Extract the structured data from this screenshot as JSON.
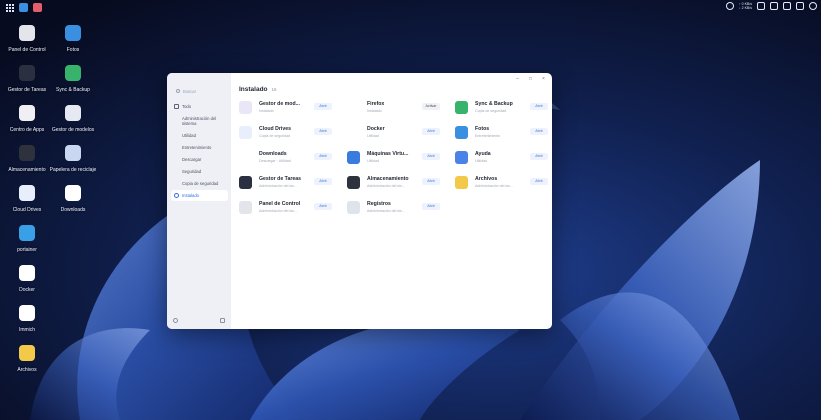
{
  "desktop": {
    "icons": [
      {
        "label": "Panel de Control",
        "icon": "control-panel-icon",
        "color": "#e3e5ea"
      },
      {
        "label": "Fotos",
        "icon": "photos-icon",
        "color": "#3a8fe0"
      },
      {
        "label": "Gestor de Tareas",
        "icon": "task-manager-icon",
        "color": "#2b3040"
      },
      {
        "label": "Sync & Backup",
        "icon": "sync-icon",
        "color": "#37b36b"
      },
      {
        "label": "Centro de Apps",
        "icon": "app-center-icon",
        "color": "#f0f0f4"
      },
      {
        "label": "Gestor de modelos",
        "icon": "model-manager-icon",
        "color": "#e7e9f2"
      },
      {
        "label": "Almacenamiento",
        "icon": "storage-icon",
        "color": "#2e323c"
      },
      {
        "label": "Papelera de reciclaje",
        "icon": "trash-icon",
        "color": "#c9d8f0"
      },
      {
        "label": "Cloud Drives",
        "icon": "cloud-drives-icon",
        "color": "#e8eefb"
      },
      {
        "label": "Downloads",
        "icon": "downloads-icon",
        "color": "#ffffff"
      },
      {
        "label": "portainer",
        "icon": "portainer-icon",
        "color": "#39a0e8"
      },
      {
        "label": "Docker",
        "icon": "docker-icon",
        "color": "#ffffff"
      },
      {
        "label": "Immich",
        "icon": "immich-icon",
        "color": "#ffffff"
      },
      {
        "label": "Archivos",
        "icon": "folder-icon",
        "color": "#f3c949"
      }
    ]
  },
  "window": {
    "search_placeholder": "Buscar",
    "sidebar": [
      {
        "label": "Todo",
        "icon": "grid-icon",
        "active": false,
        "sub": false
      },
      {
        "label": "Administración del sistema",
        "active": false,
        "sub": true
      },
      {
        "label": "Utilidad",
        "active": false,
        "sub": true
      },
      {
        "label": "Entretenimiento",
        "active": false,
        "sub": true
      },
      {
        "label": "Descargar",
        "active": false,
        "sub": true
      },
      {
        "label": "Seguridad",
        "active": false,
        "sub": true
      },
      {
        "label": "Copia de seguridad",
        "active": false,
        "sub": true
      },
      {
        "label": "Instalado",
        "icon": "user-icon",
        "active": true,
        "sub": false
      }
    ],
    "title": "Instalado",
    "count": "16",
    "apps": [
      {
        "name": "Gestor de mod...",
        "desc": "Instalado",
        "button": "Abrir",
        "icon": "model-manager-icon",
        "color": "#e9e6f7"
      },
      {
        "name": "Firefox",
        "desc": "Instalado",
        "button": "Activar",
        "icon": "firefox-icon",
        "color": "#ffffff"
      },
      {
        "name": "Sync & Backup",
        "desc": "Copia de seguridad",
        "button": "Abrir",
        "icon": "sync-icon",
        "color": "#37b36b"
      },
      {
        "name": "Cloud Drives",
        "desc": "Copia de seguridad",
        "button": "Abrir",
        "icon": "cloud-drives-icon",
        "color": "#e8eefb"
      },
      {
        "name": "Docker",
        "desc": "Utilidad",
        "button": "Abrir",
        "icon": "docker-icon",
        "color": "#ffffff"
      },
      {
        "name": "Fotos",
        "desc": "Entretenimiento",
        "button": "Abrir",
        "icon": "photos-icon",
        "color": "#3a8fe0"
      },
      {
        "name": "Downloads",
        "desc": "Descargar · Utilidad",
        "button": "Abrir",
        "icon": "downloads-icon",
        "color": "#ffffff"
      },
      {
        "name": "Máquinas Virtu...",
        "desc": "Utilidad",
        "button": "Abrir",
        "icon": "vm-icon",
        "color": "#3a7be0"
      },
      {
        "name": "Ayuda",
        "desc": "Utilidad",
        "button": "Abrir",
        "icon": "help-icon",
        "color": "#4a82e8"
      },
      {
        "name": "Gestor de Tareas",
        "desc": "Administración del sis...",
        "button": "Abrir",
        "icon": "task-manager-icon",
        "color": "#2b3040"
      },
      {
        "name": "Almacenamiento",
        "desc": "Administración del sis...",
        "button": "Abrir",
        "icon": "storage-icon",
        "color": "#2e323c"
      },
      {
        "name": "Archivos",
        "desc": "Administración del sis...",
        "button": "Abrir",
        "icon": "folder-icon",
        "color": "#f3c949"
      },
      {
        "name": "Panel de Control",
        "desc": "Administración del sis...",
        "button": "Abrir",
        "icon": "control-panel-icon",
        "color": "#e3e5ea"
      },
      {
        "name": "Registros",
        "desc": "Administración del sis...",
        "button": "Abrir",
        "icon": "logs-icon",
        "color": "#dfe3ec"
      }
    ]
  },
  "topbar": {
    "speed_up": "↑ 0 KB/s",
    "speed_down": "↓ 2 KB/s"
  },
  "colors": {
    "accent": "#2c6fe8",
    "wallpaper": "#0b1230"
  }
}
